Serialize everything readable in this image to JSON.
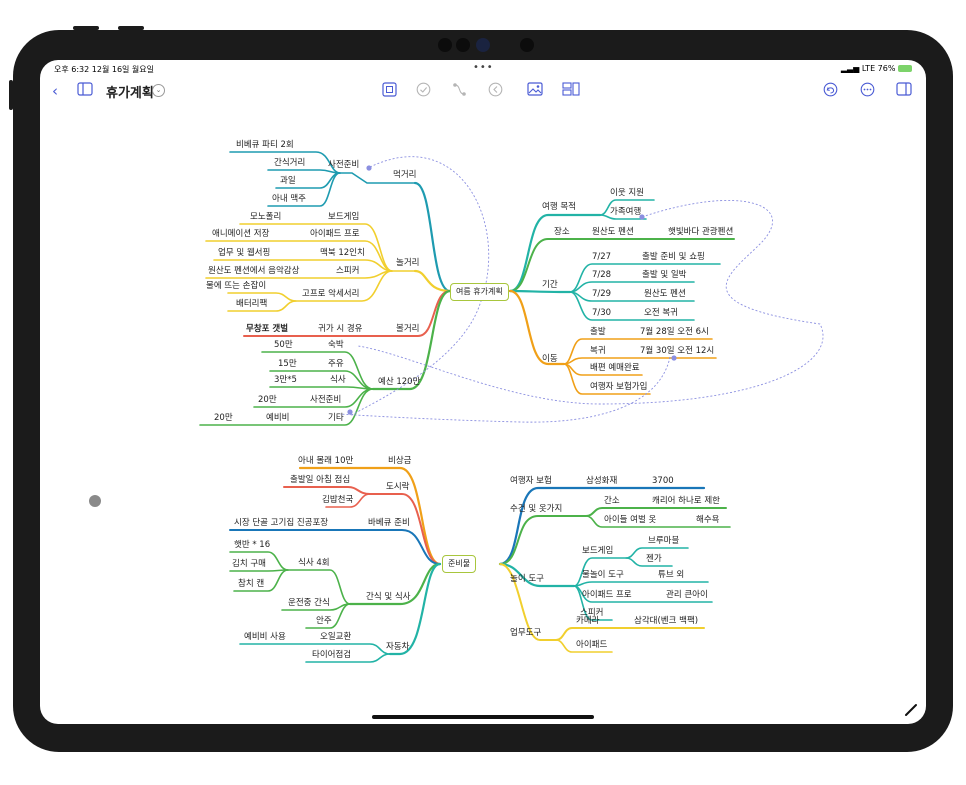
{
  "status": {
    "time_date": "오후 6:32  12월 16일 월요일",
    "dots": "•••",
    "right": "LTE  76%"
  },
  "toolbar": {
    "title": "휴가계획"
  },
  "colors": {
    "accent": "#4a5bd4",
    "teal": "#1e9bb0",
    "yellow": "#f1cf2e",
    "green": "#4cb24a",
    "sea": "#22b3a6",
    "orange": "#f0a018",
    "red": "#e8604e",
    "navy": "#1976b8"
  },
  "map1": {
    "root": "여름 휴가계획",
    "meals": {
      "label": "먹거리",
      "group": "사전준비",
      "items": [
        "비베큐 파티 2회",
        "간식거리",
        "과일",
        "아내 맥주"
      ]
    },
    "play": {
      "label": "놀거리",
      "items": [
        "보드게임",
        "아이패드 프로",
        "맥북 12인치",
        "스피커",
        "고프로 악세서리"
      ],
      "subs": [
        "모노폴리",
        "애니메이션 저장",
        "업무 및 웹서핑",
        "원산도 펜션에서 음악감상",
        "물에 뜨는 손잡이",
        "배터리팩"
      ]
    },
    "fun": {
      "label": "볼거리",
      "item": "귀가 시 경유",
      "sub": "무창포 갯벌"
    },
    "budget": {
      "label": "예산 120만",
      "items": [
        {
          "k": "숙박",
          "v": "50만"
        },
        {
          "k": "주유",
          "v": "15만"
        },
        {
          "k": "식사",
          "v": "3만*5"
        },
        {
          "k": "사전준비",
          "v": "20만"
        },
        {
          "k": "기타",
          "sub": "예비비",
          "v": "20만"
        }
      ]
    },
    "purpose": {
      "label": "여행 목적",
      "items": [
        "이웃 지원",
        "가족여행"
      ]
    },
    "place": {
      "label": "장소",
      "item": "원산도 펜션",
      "sub": "햇빛바다 관광펜션"
    },
    "period": {
      "label": "기간",
      "items": [
        {
          "d": "7/27",
          "t": "출발 준비 및 쇼핑"
        },
        {
          "d": "7/28",
          "t": "출발 및 일박"
        },
        {
          "d": "7/29",
          "t": "원산도 펜션"
        },
        {
          "d": "7/30",
          "t": "오전 복귀"
        }
      ]
    },
    "move": {
      "label": "이동",
      "items": [
        {
          "k": "출발",
          "v": "7월 28일 오전 6시"
        },
        {
          "k": "복귀",
          "v": "7월 30일 오전 12시"
        }
      ],
      "extra": [
        "배편 예매완료",
        "여행자 보험가입"
      ]
    }
  },
  "map2": {
    "root": "준비물",
    "emergency": {
      "label": "비상금",
      "item": "아내 몰래 10만"
    },
    "lunch": {
      "label": "도시락",
      "items": [
        "출발일 아침 점심",
        "김밥천국"
      ]
    },
    "bbq": {
      "label": "바베큐 준비",
      "item": "시장 단골 고기집 진공포장"
    },
    "snack": {
      "label": "간식 및 식사",
      "items": [
        "식사 4회",
        "운전중 간식",
        "안주"
      ],
      "subs": [
        "햇반 * 16",
        "김치 구매",
        "참치 캔"
      ]
    },
    "car": {
      "label": "자동차",
      "items": [
        "오일교환",
        "타이어점검"
      ],
      "sub": "예비비 사용"
    },
    "insurance": {
      "label": "여행자 보험",
      "item": "삼성화재",
      "sub": "3700"
    },
    "clothes": {
      "label": "수건 및 옷가지",
      "items": [
        "간소",
        "아이들 여벌 옷"
      ],
      "subs": [
        "캐리어 하나로 제한",
        "해수욕"
      ]
    },
    "toys": {
      "label": "놀이 도구",
      "items": [
        "보드게임",
        "물놀이 도구",
        "아이패드 프로",
        "스피커"
      ],
      "subs": [
        "브루마블",
        "젠가",
        "튜브 외",
        "관리 큰아이"
      ]
    },
    "work": {
      "label": "업무도구",
      "items": [
        "카메라",
        "아이패드"
      ],
      "sub": "삼각대(벤크 백팩)"
    }
  }
}
